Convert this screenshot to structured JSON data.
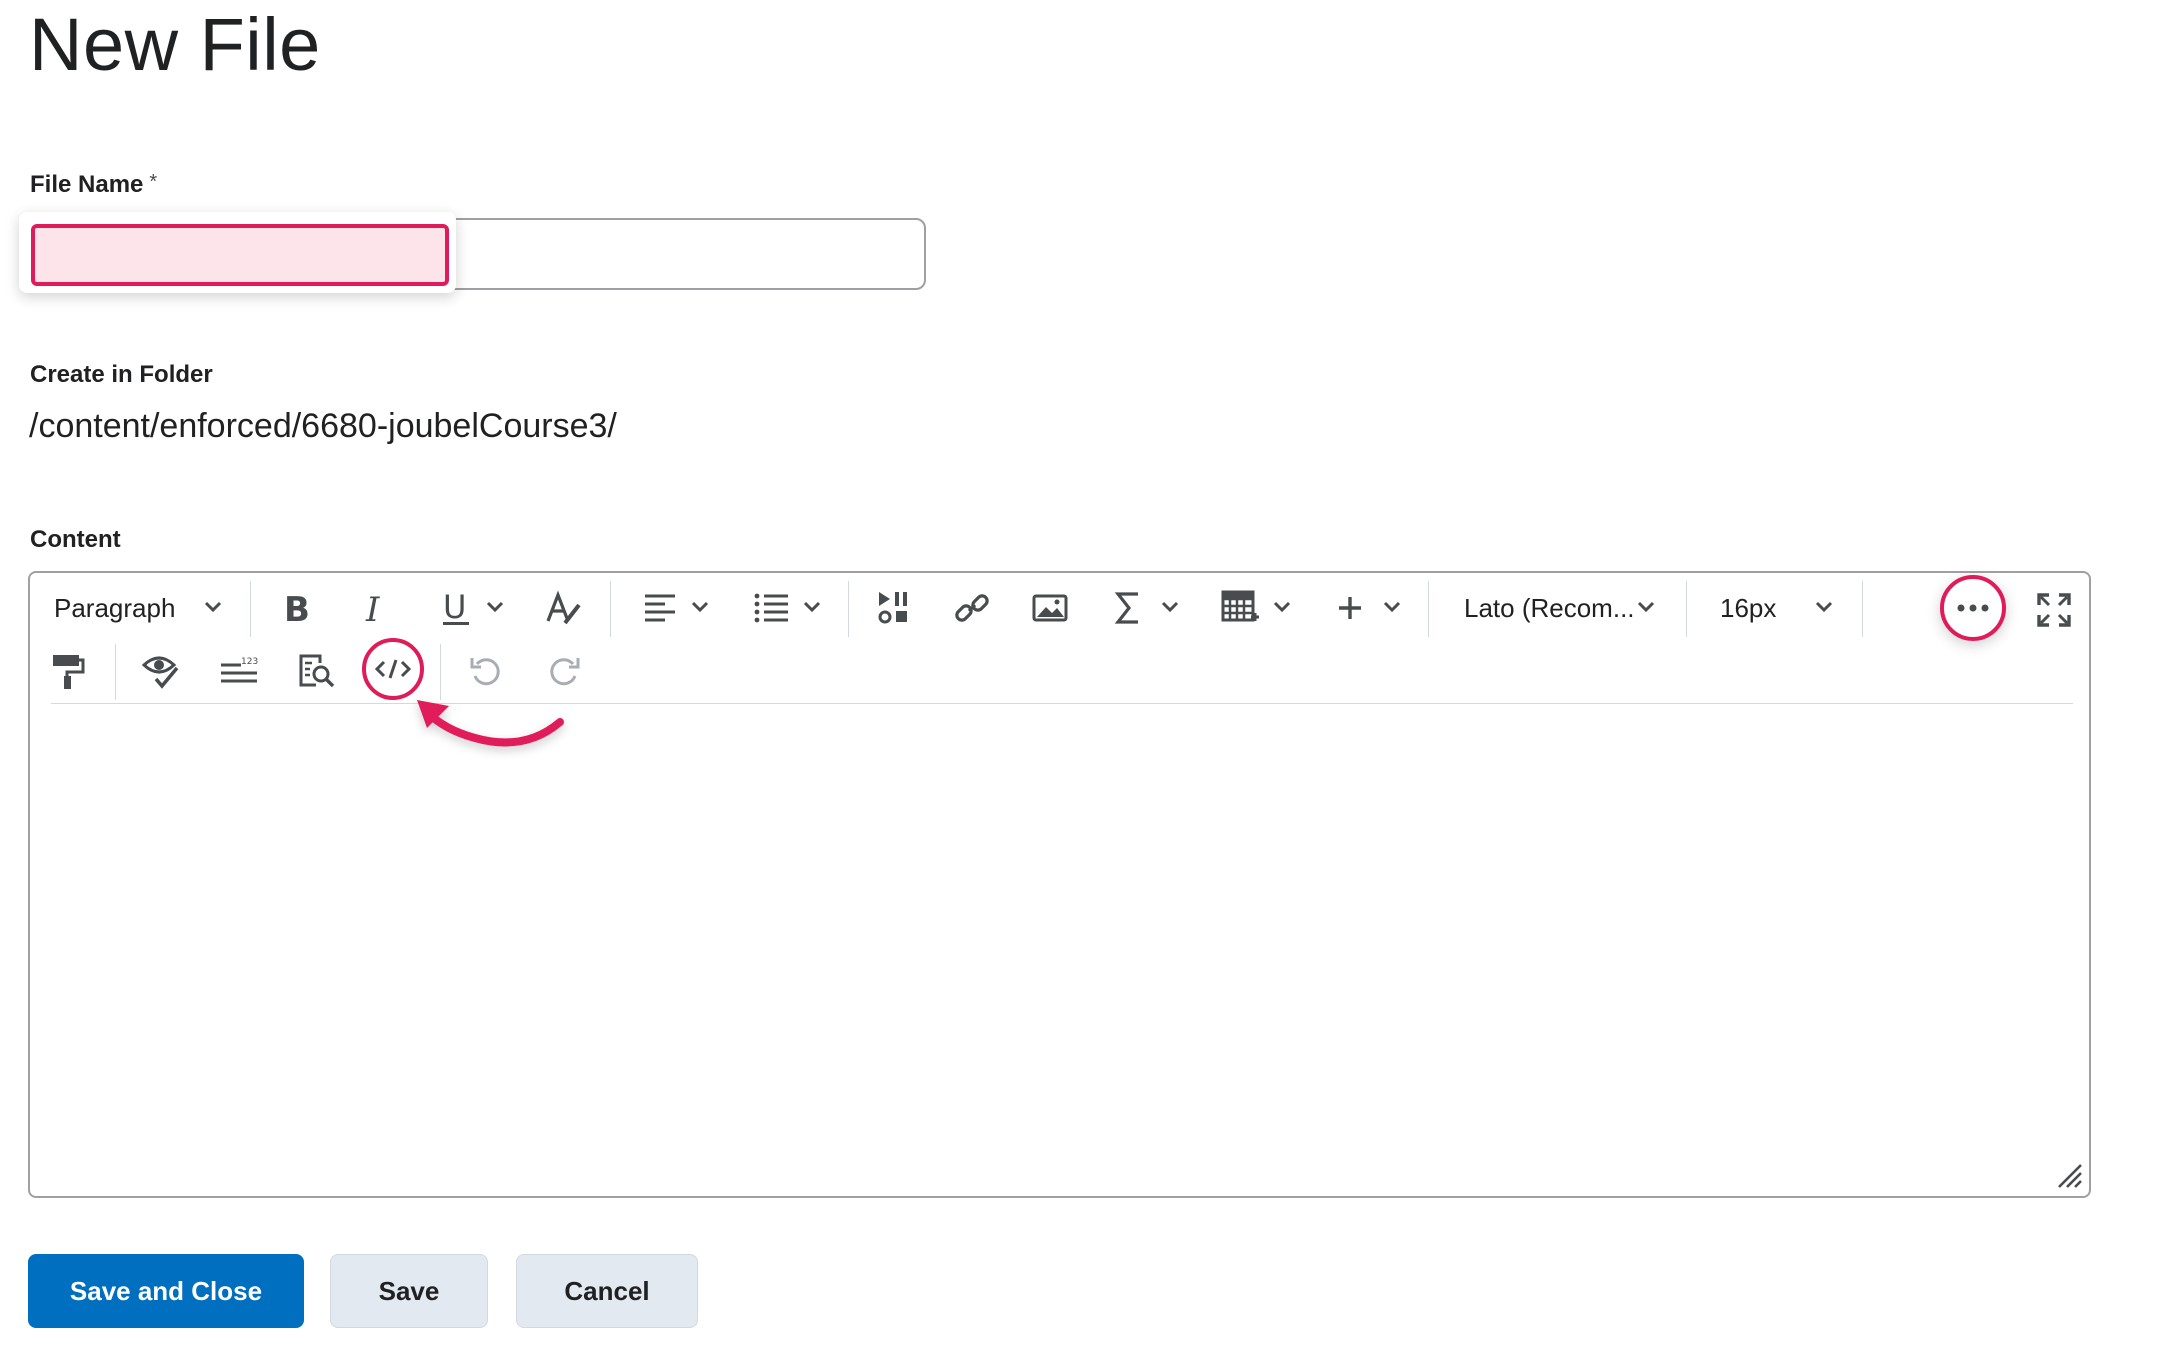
{
  "page": {
    "title": "New File"
  },
  "file_name": {
    "label": "File Name",
    "required_marker": "*",
    "value": ""
  },
  "folder": {
    "label": "Create in Folder",
    "path": "/content/enforced/6680-joubelCourse3/"
  },
  "content": {
    "label": "Content",
    "toolbar": {
      "row1": {
        "block_format": "Paragraph",
        "font_family": "Lato (Recom...",
        "font_size": "16px"
      },
      "icons": [
        "bold-icon",
        "italic-icon",
        "underline-icon",
        "text-color-icon",
        "align-left-icon",
        "bullet-list-icon",
        "insert-stuff-icon",
        "link-icon",
        "image-icon",
        "equation-icon",
        "table-icon",
        "insert-plus-icon",
        "more-actions-icon",
        "fullscreen-icon",
        "format-painter-icon",
        "accessibility-checker-icon",
        "word-count-icon",
        "preview-icon",
        "source-code-icon",
        "undo-icon",
        "redo-icon"
      ]
    },
    "body": ""
  },
  "buttons": {
    "save_close": "Save and Close",
    "save": "Save",
    "cancel": "Cancel"
  },
  "colors": {
    "highlight": "#e01b5a",
    "primary": "#006fbf"
  }
}
